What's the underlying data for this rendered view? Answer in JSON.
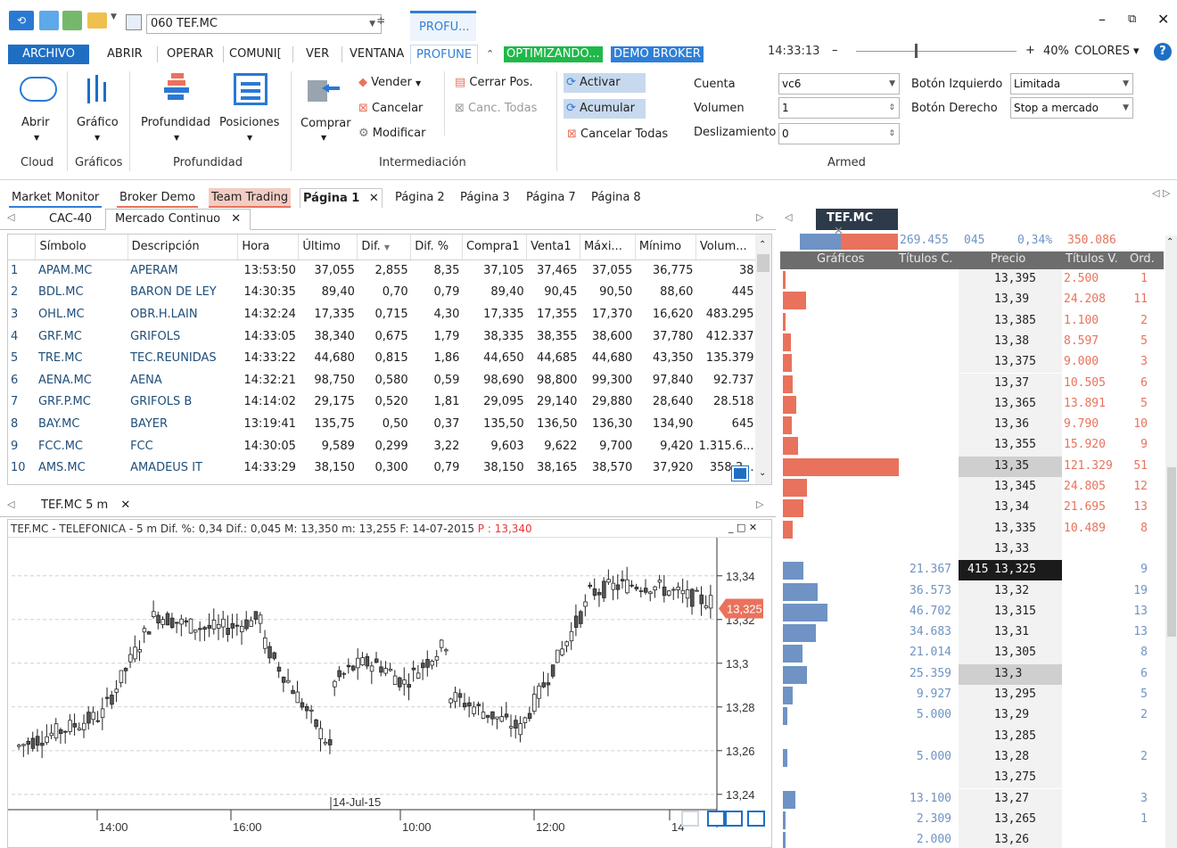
{
  "window": {
    "symbol_combo": "060 TEF.MC",
    "active_tab_hint": "PROFU...",
    "time": "14:33:13",
    "zoom": "40%",
    "colors_label": "COLORES"
  },
  "menu": {
    "items": [
      "ARCHIVO",
      "ABRIR",
      "OPERAR",
      "COMUNI[",
      "VER",
      "VENTANA",
      "PROFUNE"
    ],
    "status_optimizing": "OPTIMIZANDO...",
    "status_demo": "DEMO BROKER"
  },
  "ribbon": {
    "abrir": "Abrir",
    "grafico": "Gráfico",
    "profundidad": "Profundidad",
    "posiciones": "Posiciones",
    "comprar": "Comprar",
    "vender": "Vender",
    "cancelar": "Cancelar",
    "modificar": "Modificar",
    "cerrar_pos": "Cerrar Pos.",
    "canc_todas": "Canc. Todas",
    "activar": "Activar",
    "acumular": "Acumular",
    "cancelar_todas": "Cancelar Todas",
    "cuenta_label": "Cuenta",
    "cuenta_value": "vc6",
    "volumen_label": "Volumen",
    "volumen_value": "1",
    "desliz_label": "Deslizamiento",
    "desliz_value": "0",
    "boton_izq_label": "Botón Izquierdo",
    "boton_izq_value": "Limitada",
    "boton_der_label": "Botón Derecho",
    "boton_der_value": "Stop a mercado",
    "groups": {
      "cloud": "Cloud",
      "graficos": "Gráficos",
      "profundidad": "Profundidad",
      "intermediacion": "Intermediación",
      "armed": "Armed"
    }
  },
  "page_tabs": [
    "Market Monitor",
    "Broker Demo",
    "Team Trading",
    "Página 1",
    "Página 2",
    "Página 3",
    "Página 7",
    "Página 8"
  ],
  "sub_tabs": [
    "CAC-40",
    "Mercado Continuo"
  ],
  "grid": {
    "columns": [
      "Símbolo",
      "Descripción",
      "Hora",
      "Último",
      "Dif.",
      "Dif. %",
      "Compra1",
      "Venta1",
      "Máxi...",
      "Mínimo",
      "Volum..."
    ],
    "rows": [
      [
        "1",
        "APAM.MC",
        "APERAM",
        "13:53:50",
        "37,055",
        "2,855",
        "8,35",
        "37,105",
        "37,465",
        "37,055",
        "36,775",
        "38"
      ],
      [
        "2",
        "BDL.MC",
        "BARON DE LEY",
        "14:30:35",
        "89,40",
        "0,70",
        "0,79",
        "89,40",
        "90,45",
        "90,50",
        "88,60",
        "445"
      ],
      [
        "3",
        "OHL.MC",
        "OBR.H.LAIN",
        "14:32:24",
        "17,335",
        "0,715",
        "4,30",
        "17,335",
        "17,355",
        "17,370",
        "16,620",
        "483.295"
      ],
      [
        "4",
        "GRF.MC",
        "GRIFOLS",
        "14:33:05",
        "38,340",
        "0,675",
        "1,79",
        "38,335",
        "38,355",
        "38,600",
        "37,780",
        "412.337"
      ],
      [
        "5",
        "TRE.MC",
        "TEC.REUNIDAS",
        "14:33:22",
        "44,680",
        "0,815",
        "1,86",
        "44,650",
        "44,685",
        "44,680",
        "43,350",
        "135.379"
      ],
      [
        "6",
        "AENA.MC",
        "AENA",
        "14:32:21",
        "98,750",
        "0,580",
        "0,59",
        "98,690",
        "98,800",
        "99,300",
        "97,840",
        "92.737"
      ],
      [
        "7",
        "GRF.P.MC",
        "GRIFOLS B",
        "14:14:02",
        "29,175",
        "0,520",
        "1,81",
        "29,095",
        "29,140",
        "29,880",
        "28,640",
        "28.518"
      ],
      [
        "8",
        "BAY.MC",
        "BAYER",
        "13:19:41",
        "135,75",
        "0,50",
        "0,37",
        "135,50",
        "136,50",
        "136,30",
        "134,90",
        "645"
      ],
      [
        "9",
        "FCC.MC",
        "FCC",
        "14:30:05",
        "9,589",
        "0,299",
        "3,22",
        "9,603",
        "9,622",
        "9,700",
        "9,420",
        "1.315.6..."
      ],
      [
        "10",
        "AMS.MC",
        "AMADEUS IT",
        "14:33:29",
        "38,150",
        "0,300",
        "0,79",
        "38,150",
        "38,165",
        "38,570",
        "37,920",
        "358.3..."
      ]
    ]
  },
  "chart_tab": "TEF.MC 5 m",
  "chart_header": {
    "prefix": "TEF.MC - TELEFONICA -  5 m  Dif. %: 0,34  Dif.: 0,045  M: 13,350  m: 13,255  F: 14-07-2015 ",
    "last": "P : 13,340"
  },
  "chart_data": {
    "type": "candlestick",
    "y_ticks": [
      "13,34",
      "13,32",
      "13,3",
      "13,28",
      "13,26",
      "13,24"
    ],
    "x_ticks": [
      "14:00",
      "16:00",
      "10:00",
      "12:00",
      "14"
    ],
    "date_label": "14-Jul-15",
    "last_price_label": "13,325",
    "ylim": [
      13.233,
      13.355
    ]
  },
  "orderbook": {
    "tab": "TEF.MC",
    "summary": {
      "left": "269.455",
      "diff": "045",
      "pct": "0,34%",
      "right": "350.086"
    },
    "headers": [
      "Gráficos",
      "Títulos C.",
      "Precio",
      "Títulos V.",
      "Ord."
    ],
    "asks": [
      {
        "price": "13,395",
        "qty": "2.500",
        "ord": "1"
      },
      {
        "price": "13,39",
        "qty": "24.208",
        "ord": "11"
      },
      {
        "price": "13,385",
        "qty": "1.100",
        "ord": "2"
      },
      {
        "price": "13,38",
        "qty": "8.597",
        "ord": "5"
      },
      {
        "price": "13,375",
        "qty": "9.000",
        "ord": "3"
      },
      {
        "price": "13,37",
        "qty": "10.505",
        "ord": "6"
      },
      {
        "price": "13,365",
        "qty": "13.891",
        "ord": "5"
      },
      {
        "price": "13,36",
        "qty": "9.790",
        "ord": "10"
      },
      {
        "price": "13,355",
        "qty": "15.920",
        "ord": "9"
      },
      {
        "price": "13,35",
        "qty": "121.329",
        "ord": "51"
      },
      {
        "price": "13,345",
        "qty": "24.805",
        "ord": "12"
      },
      {
        "price": "13,34",
        "qty": "21.695",
        "ord": "13"
      },
      {
        "price": "13,335",
        "qty": "10.489",
        "ord": "8"
      },
      {
        "price": "13,33",
        "qty": "",
        "ord": ""
      }
    ],
    "bids": [
      {
        "price": "13,325",
        "qty": "21.367",
        "ord": "9",
        "last": "415"
      },
      {
        "price": "13,32",
        "qty": "36.573",
        "ord": "19"
      },
      {
        "price": "13,315",
        "qty": "46.702",
        "ord": "13"
      },
      {
        "price": "13,31",
        "qty": "34.683",
        "ord": "13"
      },
      {
        "price": "13,305",
        "qty": "21.014",
        "ord": "8"
      },
      {
        "price": "13,3",
        "qty": "25.359",
        "ord": "6"
      },
      {
        "price": "13,295",
        "qty": "9.927",
        "ord": "5"
      },
      {
        "price": "13,29",
        "qty": "5.000",
        "ord": "2"
      },
      {
        "price": "13,285",
        "qty": "",
        "ord": ""
      },
      {
        "price": "13,28",
        "qty": "5.000",
        "ord": "2"
      },
      {
        "price": "13,275",
        "qty": "",
        "ord": ""
      },
      {
        "price": "13,27",
        "qty": "13.100",
        "ord": "3"
      },
      {
        "price": "13,265",
        "qty": "2.309",
        "ord": "1"
      },
      {
        "price": "13,26",
        "qty": "2.000",
        "ord": ""
      }
    ]
  },
  "colors": {
    "accent": "#1e6fc4",
    "ask": "#e9725c",
    "bid": "#6e93c4",
    "status_green": "#20b84a",
    "status_blue": "#2f7fd6"
  }
}
